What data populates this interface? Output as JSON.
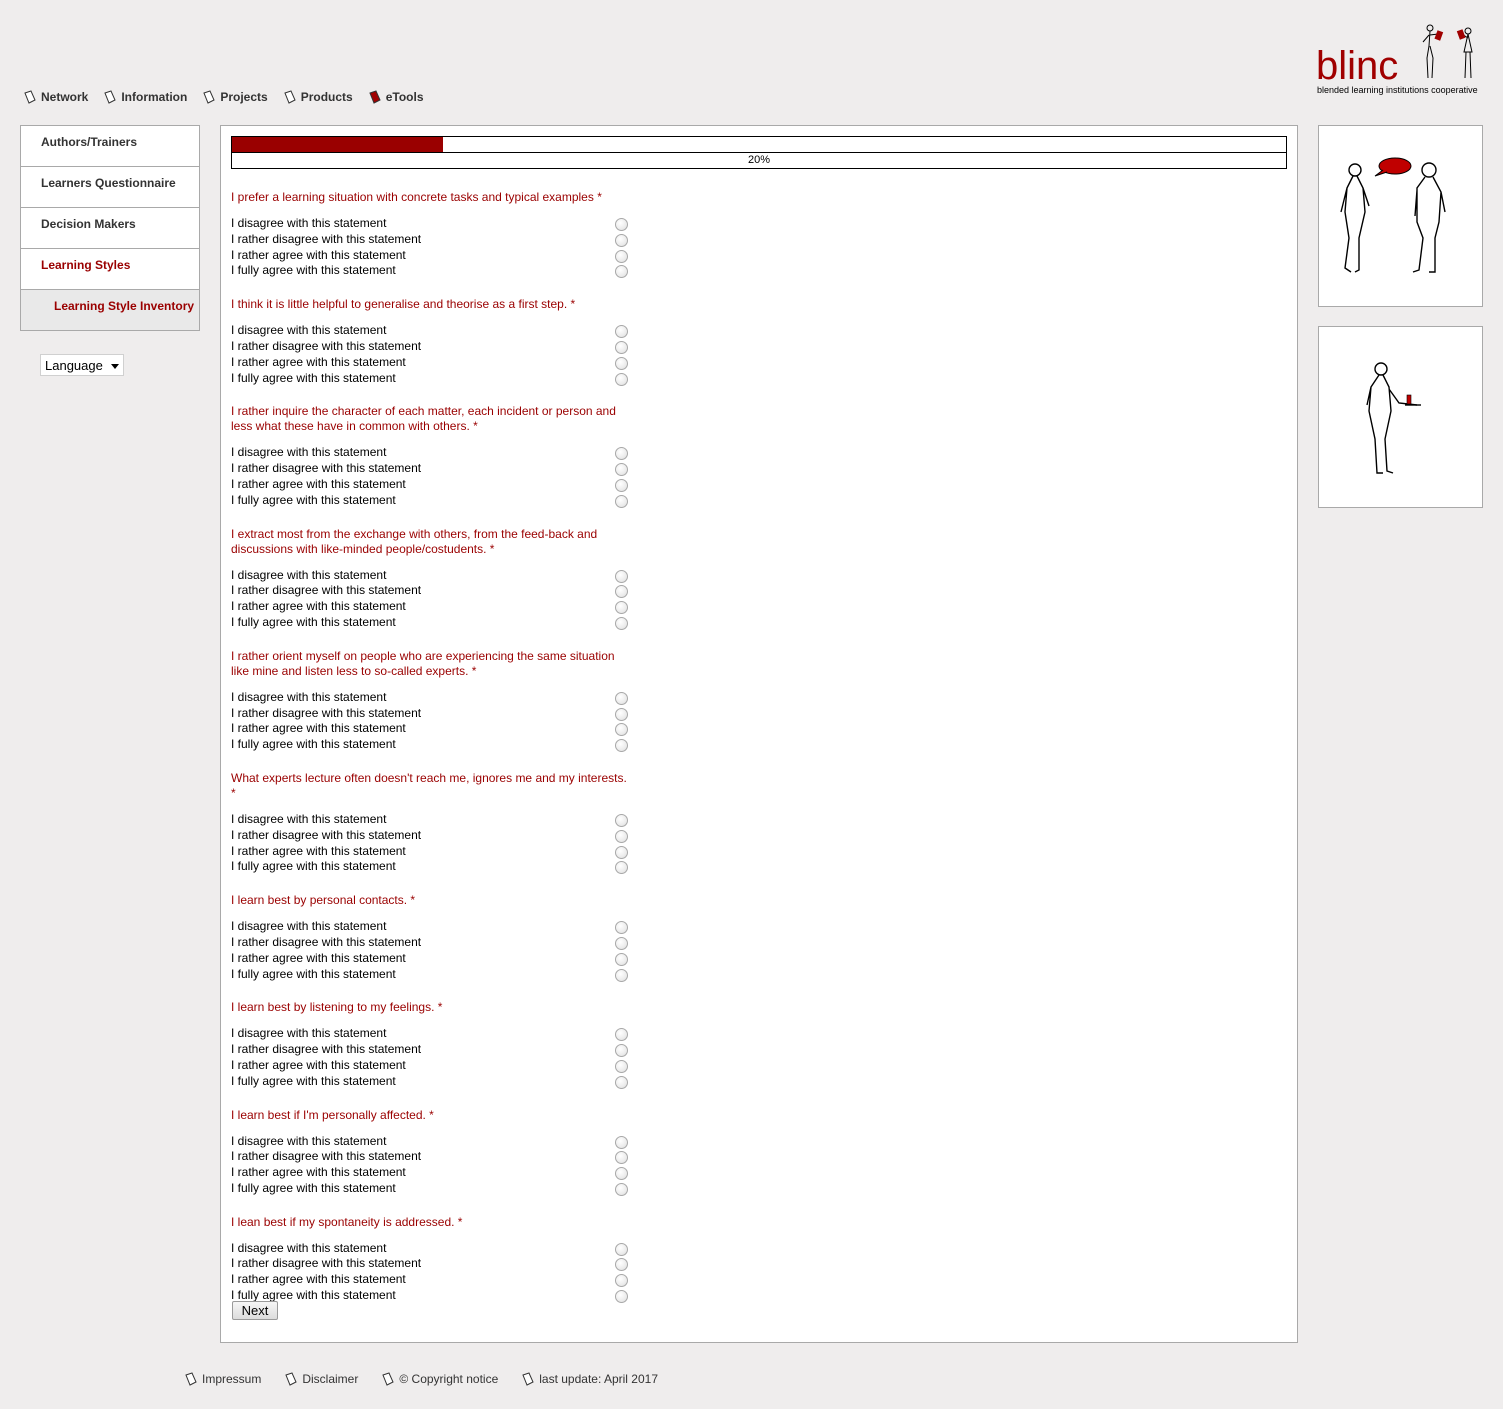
{
  "brand": {
    "logo_text": "blinc",
    "tagline": "blended learning institutions cooperative",
    "accent_color": "#9a0000"
  },
  "topnav": [
    {
      "label": "Network",
      "icon": "page-icon"
    },
    {
      "label": "Information",
      "icon": "page-icon"
    },
    {
      "label": "Projects",
      "icon": "page-icon"
    },
    {
      "label": "Products",
      "icon": "page-icon"
    },
    {
      "label": "eTools",
      "icon": "red-book-icon"
    }
  ],
  "sidebar": {
    "items": [
      {
        "label": "Authors/Trainers"
      },
      {
        "label": "Learners Questionnaire"
      },
      {
        "label": "Decision Makers"
      },
      {
        "label": "Learning Styles"
      },
      {
        "label": "Learning Style Inventory"
      }
    ],
    "language_label": "Language"
  },
  "progress": {
    "fraction": 0.2,
    "label": "20%"
  },
  "options": [
    "I disagree with this statement",
    "I rather disagree with this statement",
    "I rather agree with this statement",
    "I fully agree with this statement"
  ],
  "questions": [
    {
      "title": "I prefer a learning situation with concrete tasks and typical examples *"
    },
    {
      "title": "I think it is little helpful to generalise and theorise as a first step. *"
    },
    {
      "title": "I rather inquire the character of each matter, each incident or person and less what these have in common with others. *"
    },
    {
      "title": "I extract most from the exchange with others, from the feed-back and discussions with like-minded people/costudents. *"
    },
    {
      "title": "I rather orient myself on people who are experiencing the same situation like mine and listen less to so-called experts. *"
    },
    {
      "title": "What experts lecture often doesn't reach me, ignores me and my interests. *"
    },
    {
      "title": "I learn best by personal contacts. *"
    },
    {
      "title": "I learn best by listening to my feelings. *"
    },
    {
      "title": "I learn best if I'm personally affected. *"
    },
    {
      "title": "I lean best if my spontaneity is addressed. *"
    }
  ],
  "next_label": "Next",
  "footer": [
    {
      "label": "Impressum"
    },
    {
      "label": "Disclaimer"
    },
    {
      "label": "© Copyright notice"
    },
    {
      "label": "last update: April 2017"
    }
  ]
}
